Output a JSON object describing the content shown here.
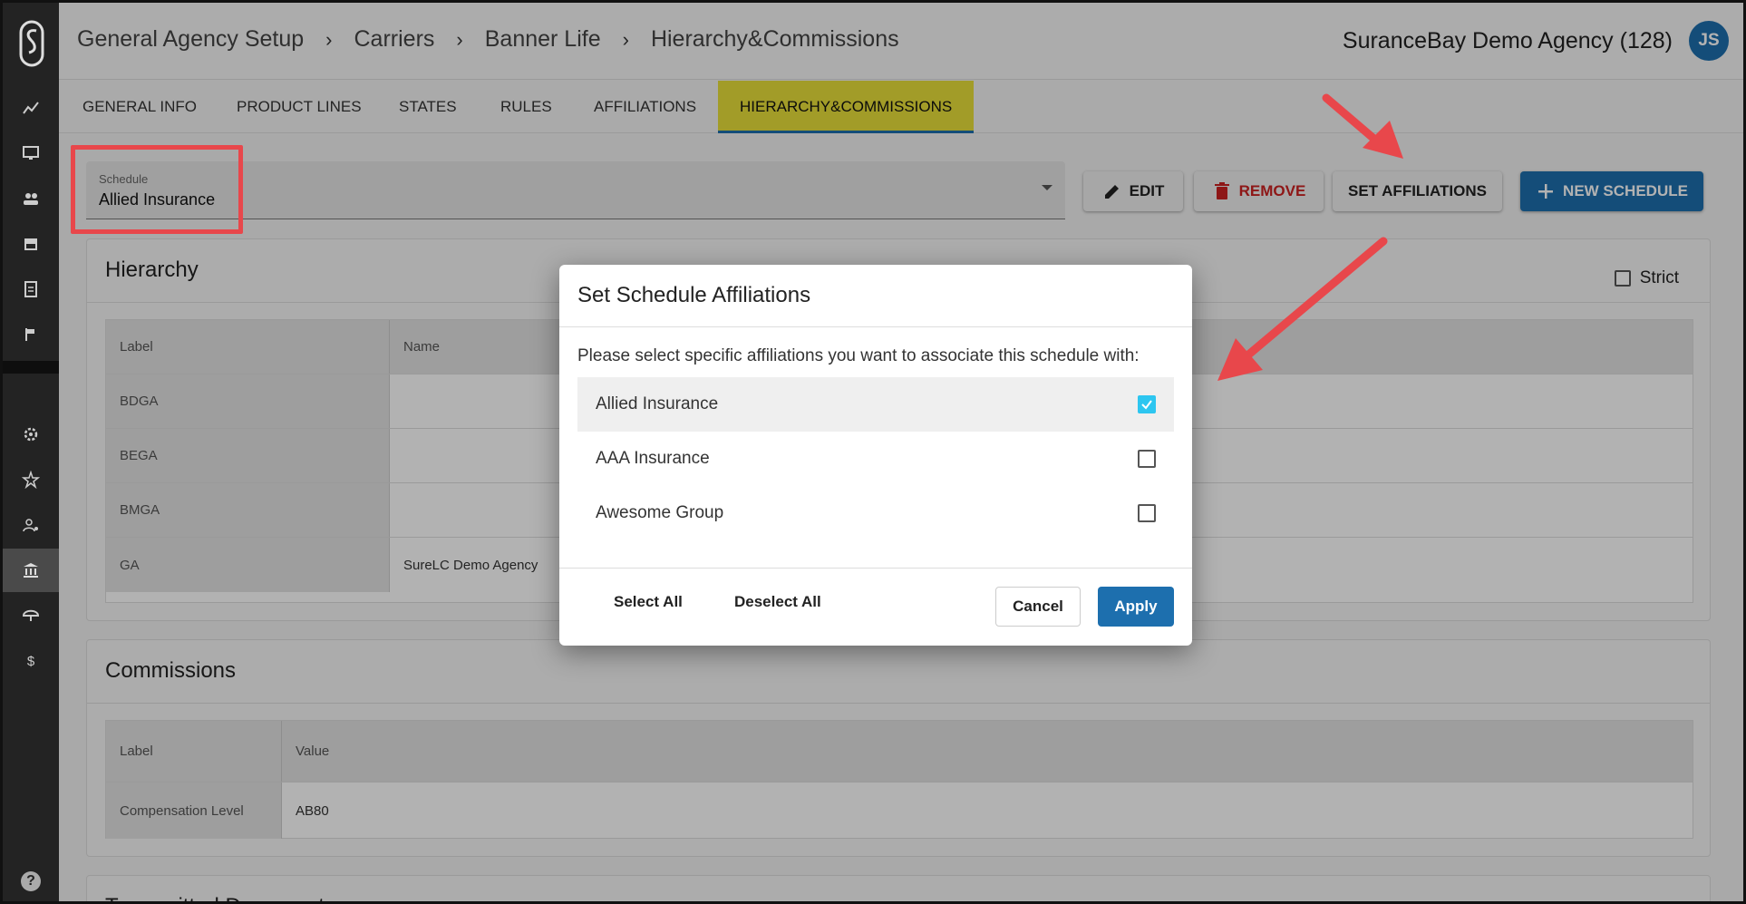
{
  "breadcrumb": [
    "General Agency Setup",
    "Carriers",
    "Banner Life",
    "Hierarchy&Commissions"
  ],
  "agency_name": "SuranceBay Demo Agency (128)",
  "user_initials": "JS",
  "tabs": [
    {
      "label": "GENERAL INFO"
    },
    {
      "label": "PRODUCT LINES"
    },
    {
      "label": "STATES"
    },
    {
      "label": "RULES"
    },
    {
      "label": "AFFILIATIONS"
    },
    {
      "label": "HIERARCHY&COMMISSIONS"
    }
  ],
  "schedule": {
    "label": "Schedule",
    "value": "Allied Insurance"
  },
  "toolbar": {
    "edit_label": "EDIT",
    "remove_label": "REMOVE",
    "set_affiliations_label": "SET AFFILIATIONS",
    "new_schedule_label": "NEW SCHEDULE"
  },
  "hierarchy": {
    "title": "Hierarchy",
    "strict_label": "Strict",
    "columns": [
      "Label",
      "Name"
    ],
    "rows": [
      {
        "label": "BDGA",
        "name": ""
      },
      {
        "label": "BEGA",
        "name": ""
      },
      {
        "label": "BMGA",
        "name": ""
      },
      {
        "label": "GA",
        "name": "SureLC Demo Agency"
      }
    ]
  },
  "commissions": {
    "title": "Commissions",
    "columns": [
      "Label",
      "Value"
    ],
    "rows": [
      {
        "label": "Compensation Level",
        "value": "AB80"
      }
    ]
  },
  "next_section_partial": "Transmitted Documents",
  "dialog": {
    "title": "Set Schedule Affiliations",
    "prompt": "Please select specific affiliations you want to associate this schedule with:",
    "affiliations": [
      {
        "name": "Allied Insurance",
        "checked": true
      },
      {
        "name": "AAA Insurance",
        "checked": false
      },
      {
        "name": "Awesome Group",
        "checked": false
      }
    ],
    "select_all_label": "Select All",
    "deselect_all_label": "Deselect All",
    "cancel_label": "Cancel",
    "apply_label": "Apply"
  },
  "sidebar": {
    "icons": [
      "analytics-icon",
      "monitor-icon",
      "people-icon",
      "store-icon",
      "document-icon",
      "flag-icon",
      "settings-icon",
      "star-badge-icon",
      "user-settings-icon",
      "bank-icon",
      "umbrella-icon",
      "dollar-icon"
    ],
    "help_label": "?"
  },
  "colors": {
    "accent": "#1d6fae",
    "active_tab_bg": "#e8e03a",
    "annotation_red": "#e8474b",
    "checkbox_checked": "#2dc6f0",
    "remove_red": "#cc2222"
  }
}
